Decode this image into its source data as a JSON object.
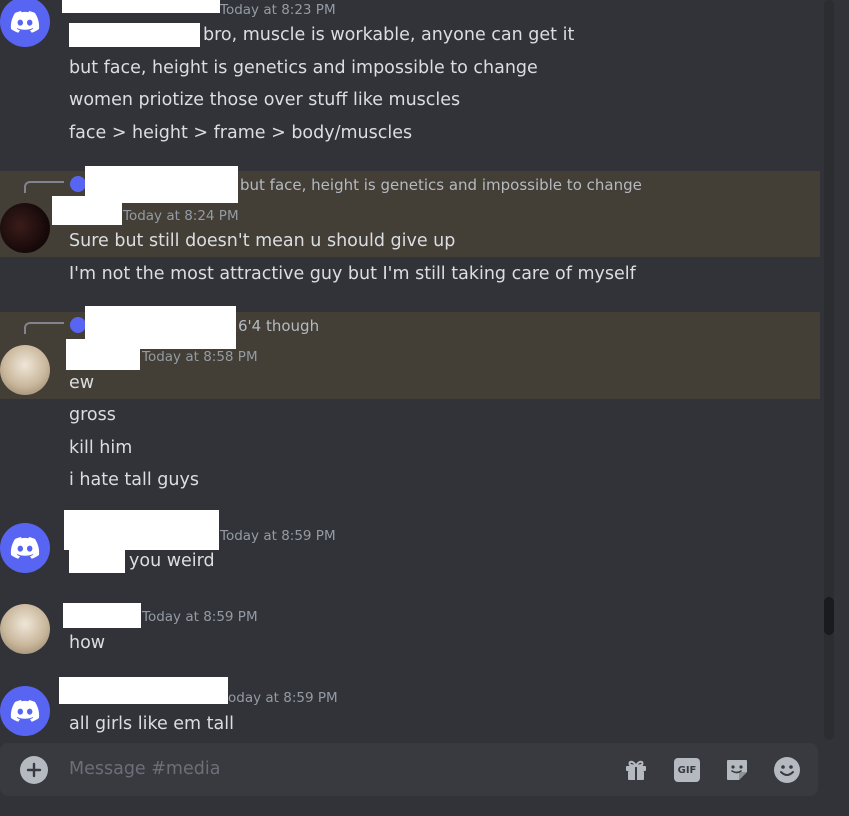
{
  "messages": {
    "m1": {
      "timestamp": "Today at 8:23 PM",
      "lines": [
        "bro, muscle is workable, anyone can get it",
        "but face, height is genetics and impossible to change",
        "women priotize those over stuff like muscles",
        "face > height > frame > body/muscles"
      ]
    },
    "m2": {
      "reply_snippet": "but face, height is genetics and impossible to change",
      "timestamp": "Today at 8:24 PM",
      "lines": [
        "Sure but still doesn't mean u should give up",
        "I'm not the most attractive guy but I'm still taking care of myself"
      ]
    },
    "m3": {
      "reply_snippet": "6'4 though",
      "timestamp": "Today at 8:58 PM",
      "lines": [
        "ew",
        "gross",
        "kill him",
        "i hate tall guys"
      ]
    },
    "m4": {
      "timestamp": "Today at 8:59 PM",
      "lines": [
        "you weird"
      ]
    },
    "m5": {
      "timestamp": "Today at 8:59 PM",
      "lines": [
        "how"
      ]
    },
    "m6": {
      "timestamp": "oday at 8:59 PM",
      "lines": [
        "all girls like em tall"
      ]
    }
  },
  "composer": {
    "placeholder": "Message #media",
    "icons": [
      "add-icon",
      "gift-icon",
      "gif-icon",
      "sticker-icon",
      "emoji-icon"
    ],
    "gif_label": "GIF"
  },
  "colors": {
    "background": "#313338",
    "highlight": "#433e36",
    "blurple": "#5865f2",
    "text": "#dbdee1",
    "muted": "#949ba4"
  }
}
